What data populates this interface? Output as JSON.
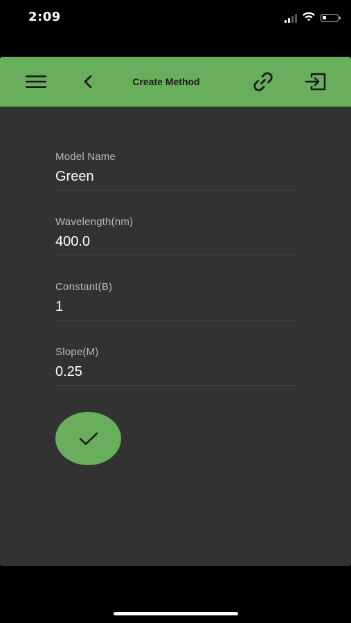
{
  "status_bar": {
    "time": "2:09",
    "icons": [
      "signal-icon",
      "wifi-icon",
      "battery-icon"
    ]
  },
  "toolbar": {
    "title": "Create Method",
    "background_color": "#68ae5c",
    "icons": [
      "menu-icon",
      "back-chevron-icon",
      "link-icon",
      "exit-icon"
    ]
  },
  "form": {
    "fields": [
      {
        "label": "Model Name",
        "value": "Green"
      },
      {
        "label": "Wavelength(nm)",
        "value": "400.0"
      },
      {
        "label": "Constant(B)",
        "value": "1"
      },
      {
        "label": "Slope(M)",
        "value": "0.25"
      }
    ]
  },
  "confirm_button": {
    "icon": "checkmark-icon",
    "color": "#68ae5c"
  },
  "theme": {
    "surface": "#323232",
    "label_text": "#b9b9b9",
    "value_text": "#ffffff"
  }
}
